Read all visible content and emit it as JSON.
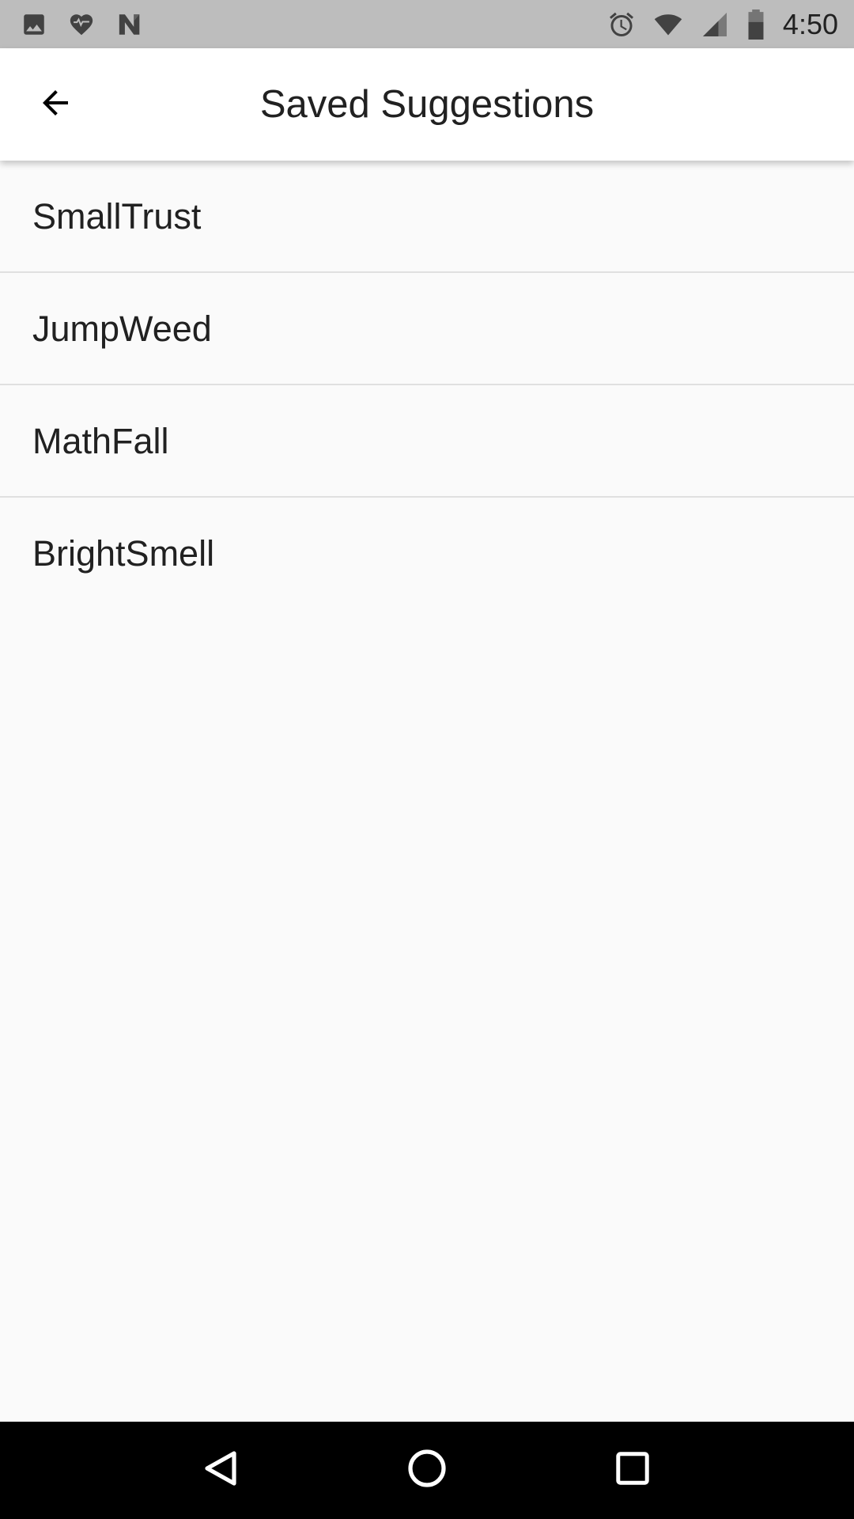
{
  "status_bar": {
    "left_icons": [
      "image-icon",
      "health-heart-icon",
      "n-logo-icon"
    ],
    "right_icons": [
      "alarm-icon",
      "wifi-icon",
      "cell-signal-icon",
      "battery-icon"
    ],
    "time": "4:50"
  },
  "app_bar": {
    "title": "Saved Suggestions",
    "back_icon": "arrow-back-icon"
  },
  "saved_suggestions": [
    {
      "label": "SmallTrust"
    },
    {
      "label": "JumpWeed"
    },
    {
      "label": "MathFall"
    },
    {
      "label": "BrightSmell"
    }
  ],
  "nav_bar": {
    "icons": [
      "nav-back-icon",
      "nav-home-icon",
      "nav-recents-icon"
    ]
  },
  "colors": {
    "status_bar_bg": "#bdbdbd",
    "app_bar_bg": "#ffffff",
    "list_bg": "#fafafa",
    "divider": "#e0e0e0",
    "text_primary": "#212121",
    "nav_bar_bg": "#000000"
  }
}
